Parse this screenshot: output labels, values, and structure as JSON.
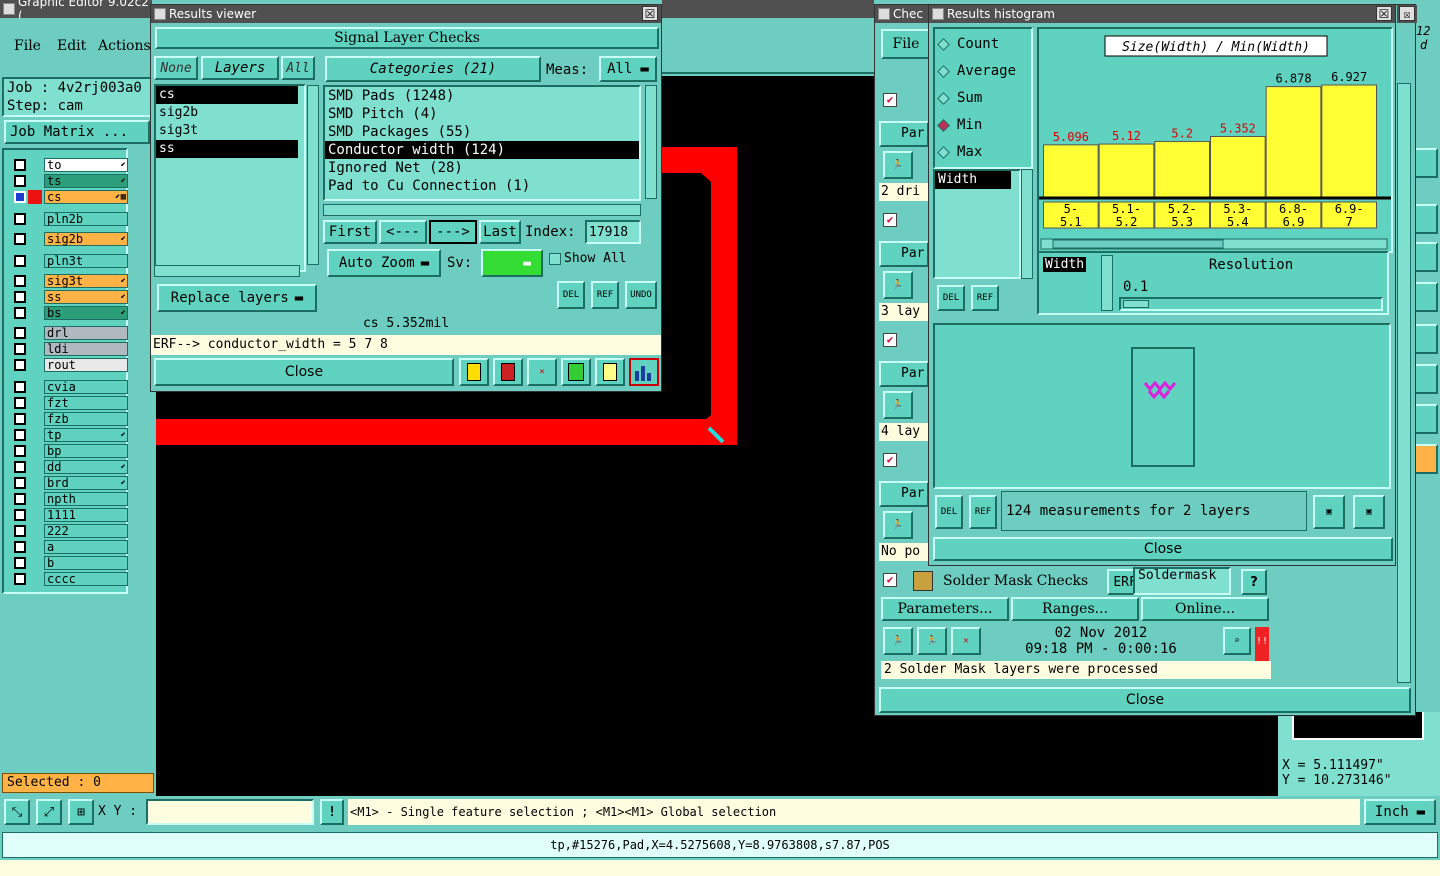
{
  "app": {
    "title": "Graphic Editor 9.02c2 (",
    "menu": [
      "File",
      "Edit",
      "Actions"
    ],
    "job_label": "Job : 4v2rj003a0",
    "step_label": "Step: cam",
    "job_matrix": "Job Matrix ...",
    "selected": "Selected : 0",
    "xy_label": "X Y :",
    "hint": "<M1> - Single feature selection ; <M1><M1> Global selection",
    "units": "Inch",
    "status_line": "tp,#15276,Pad,X=4.5275608,Y=8.9763808,s7.87,POS",
    "coord_x": "X = 5.111497\"",
    "coord_y": "Y = 10.273146\"",
    "corner_text_1": "12",
    "corner_text_2": "d"
  },
  "layers": [
    {
      "name": "to",
      "color": "#ffffff",
      "mark": "⬋"
    },
    {
      "name": "ts",
      "color": "#2d9e7a",
      "mark": "⬋"
    },
    {
      "name": "cs",
      "color": "#ffb347",
      "mark": "⬋▦",
      "active": true
    },
    {
      "name": "pln2b",
      "color": "#5fd3c0",
      "mark": ""
    },
    {
      "name": "sig2b",
      "color": "#ffb347",
      "mark": "⬋"
    },
    {
      "name": "pln3t",
      "color": "#5fd3c0",
      "mark": ""
    },
    {
      "name": "sig3t",
      "color": "#ffb347",
      "mark": "⬋"
    },
    {
      "name": "ss",
      "color": "#ffb347",
      "mark": "⬋"
    },
    {
      "name": "bs",
      "color": "#2d9e7a",
      "mark": "⬋"
    },
    {
      "name": "drl",
      "color": "#b0b8c0",
      "mark": ""
    },
    {
      "name": "ldi",
      "color": "#b0b8c0",
      "mark": ""
    },
    {
      "name": "rout",
      "color": "#e8e8e8",
      "mark": ""
    },
    {
      "name": "cvia",
      "color": "#5fd3c0",
      "mark": ""
    },
    {
      "name": "fzt",
      "color": "#5fd3c0",
      "mark": ""
    },
    {
      "name": "fzb",
      "color": "#5fd3c0",
      "mark": ""
    },
    {
      "name": "tp",
      "color": "#5fd3c0",
      "mark": "⬋"
    },
    {
      "name": "bp",
      "color": "#5fd3c0",
      "mark": ""
    },
    {
      "name": "dd",
      "color": "#5fd3c0",
      "mark": "⬋"
    },
    {
      "name": "brd",
      "color": "#5fd3c0",
      "mark": "⬋"
    },
    {
      "name": "npth",
      "color": "#5fd3c0",
      "mark": ""
    },
    {
      "name": "1111",
      "color": "#5fd3c0",
      "mark": ""
    },
    {
      "name": "222",
      "color": "#5fd3c0",
      "mark": ""
    },
    {
      "name": "a",
      "color": "#5fd3c0",
      "mark": ""
    },
    {
      "name": "b",
      "color": "#5fd3c0",
      "mark": ""
    },
    {
      "name": "cccc",
      "color": "#5fd3c0",
      "mark": ""
    }
  ],
  "results_viewer": {
    "title": "Results viewer",
    "close_x": "☒",
    "header": "Signal Layer Checks",
    "none": "None",
    "layers_btn": "Layers",
    "all": "All",
    "categories": "Categories (21)",
    "meas_label": "Meas:",
    "meas_value": "All",
    "layer_list": [
      "cs",
      "sig2b",
      "sig3t",
      "ss"
    ],
    "category_list": [
      "SMD Pads (1248)",
      "SMD Pitch (4)",
      "SMD Packages (55)",
      "Conductor width (124)",
      "Ignored Net (28)",
      "Pad to Cu Connection (1)"
    ],
    "first": "First",
    "prev": "<---",
    "next": "--->",
    "last": "Last",
    "index_label": "Index:",
    "index_value": "17918",
    "auto_zoom": "Auto Zoom",
    "sv_label": "Sv:",
    "show_all": "Show All",
    "replace_layers": "Replace layers",
    "del": "DEL",
    "ref": "REF",
    "undo": "UNDO",
    "info": "cs 5.352mil",
    "erf": "ERF--> conductor_width = 5 7 8",
    "close": "Close"
  },
  "check_window": {
    "title": "Chec",
    "file": "File",
    "rows": [
      {
        "label": "Par",
        "line": "2 dri"
      },
      {
        "label": "Par",
        "line": "3 lay"
      },
      {
        "label": "Par",
        "line": "4 lay"
      },
      {
        "label": "Par",
        "line": "No po"
      }
    ],
    "solder_mask": "Solder Mask Checks",
    "erf_label": "ERF:",
    "erf_value": "Soldermask",
    "help": "?",
    "parameters": "Parameters...",
    "ranges": "Ranges...",
    "online": "Online...",
    "date": "02 Nov 2012",
    "time": "09:18 PM - 0:00:16",
    "alert": "!!",
    "processed": "2 Solder Mask layers were processed",
    "close": "Close"
  },
  "histogram": {
    "title": "Results histogram",
    "close_x": "☒",
    "modes": [
      {
        "label": "Count",
        "on": false
      },
      {
        "label": "Average",
        "on": false
      },
      {
        "label": "Sum",
        "on": false
      },
      {
        "label": "Min",
        "on": true
      },
      {
        "label": "Max",
        "on": false
      }
    ],
    "measure_item": "Width",
    "chart_title": "Size(Width) / Min(Width)",
    "resolution_label": "Resolution",
    "resolution_value": "0.1",
    "width_label": "Width",
    "del": "DEL",
    "ref": "REF",
    "measurements": "124 measurements for 2 layers",
    "close": "Close"
  },
  "chart_data": {
    "type": "bar",
    "title": "Size(Width) / Min(Width)",
    "categories": [
      "5-\n5.1",
      "5.1-\n5.2",
      "5.2-\n5.3",
      "5.3-\n5.4",
      "6.8-\n6.9",
      "6.9-\n7"
    ],
    "values": [
      5.096,
      5.12,
      5.2,
      5.352,
      6.878,
      6.927
    ],
    "labels": [
      "5.096",
      "5.12",
      "5.2",
      "5.352",
      "6.878",
      "6.927"
    ],
    "label_colors": [
      "#e00000",
      "#e00000",
      "#e00000",
      "#e00000",
      "#000000",
      "#000000"
    ],
    "bar_color": "#ffff33",
    "ylim": [
      3.5,
      7.05
    ]
  }
}
